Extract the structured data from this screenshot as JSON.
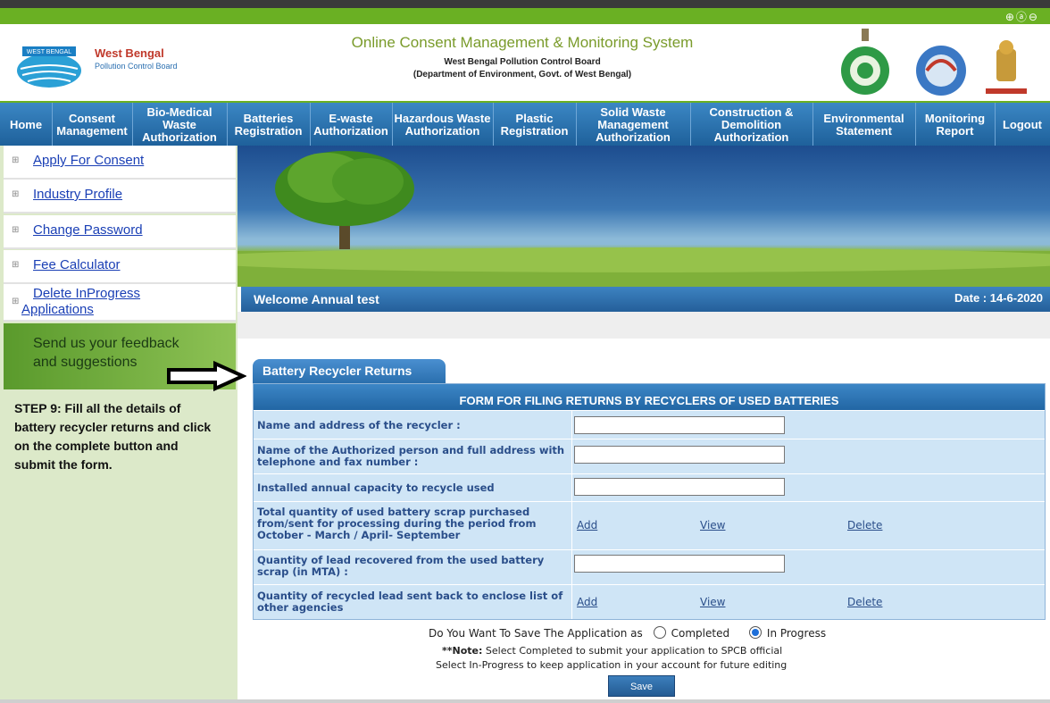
{
  "header": {
    "logo_banner": "WEST BENGAL",
    "org_name": "West Bengal",
    "org_sub": "Pollution Control Board",
    "system_title": "Online Consent Management & Monitoring System",
    "board_name": "West Bengal Pollution Control Board",
    "department": "(Department of Environment, Govt. of West Bengal)"
  },
  "nav": [
    {
      "label": "Home"
    },
    {
      "label": "Consent Management"
    },
    {
      "label": "Bio-Medical Waste Authorization"
    },
    {
      "label": "Batteries Registration"
    },
    {
      "label": "E-waste Authorization"
    },
    {
      "label": "Hazardous Waste Authorization"
    },
    {
      "label": "Plastic Registration"
    },
    {
      "label": "Solid Waste Management Authorization"
    },
    {
      "label": "Construction & Demolition Authorization"
    },
    {
      "label": "Environmental Statement"
    },
    {
      "label": "Monitoring Report"
    },
    {
      "label": "Logout"
    }
  ],
  "sidebar": {
    "items": [
      {
        "label": "Apply For Consent"
      },
      {
        "label": "Industry Profile"
      },
      {
        "label": "Change Password"
      },
      {
        "label": "Fee Calculator"
      },
      {
        "label": "Delete InProgress Applications"
      }
    ],
    "feedback_line1": "Send us your feedback",
    "feedback_line2": "and suggestions",
    "step_text": "STEP 9: Fill all the details of battery recycler returns and click on the complete button and submit the form."
  },
  "welcome": {
    "text": "Welcome Annual test",
    "date": "Date : 14-6-2020"
  },
  "form": {
    "tab_label": "Battery Recycler Returns",
    "heading": "FORM FOR FILING RETURNS BY RECYCLERS OF USED BATTERIES",
    "rows": [
      {
        "question": "Name and address of the recycler :"
      },
      {
        "question": "Name of the Authorized person and full address with telephone and fax number :"
      },
      {
        "question": "Installed annual capacity to recycle used"
      },
      {
        "question": "Total quantity of used battery scrap purchased from/sent for processing during the period from October - March / April- September"
      },
      {
        "question": "Quantity of lead recovered from the used battery scrap (in MTA) :"
      },
      {
        "question": "Quantity of recycled lead sent back to enclose list of other agencies"
      }
    ],
    "link_add": "Add",
    "link_view": "View",
    "link_delete": "Delete"
  },
  "save": {
    "question": "Do You Want To Save The Application as",
    "opt_completed": "Completed",
    "opt_inprogress": "In Progress",
    "selected": "In Progress",
    "note_label": "**Note:",
    "note_line1": "Select Completed to submit your application to SPCB official",
    "note_line2": "Select In-Progress to keep application in your account for future editing",
    "button": "Save"
  },
  "colors": {
    "nav_blue": "#2a6fae",
    "brand_green": "#6ab023",
    "sidebar_bg": "#dce9c9",
    "row_bg": "#cfe5f6"
  }
}
